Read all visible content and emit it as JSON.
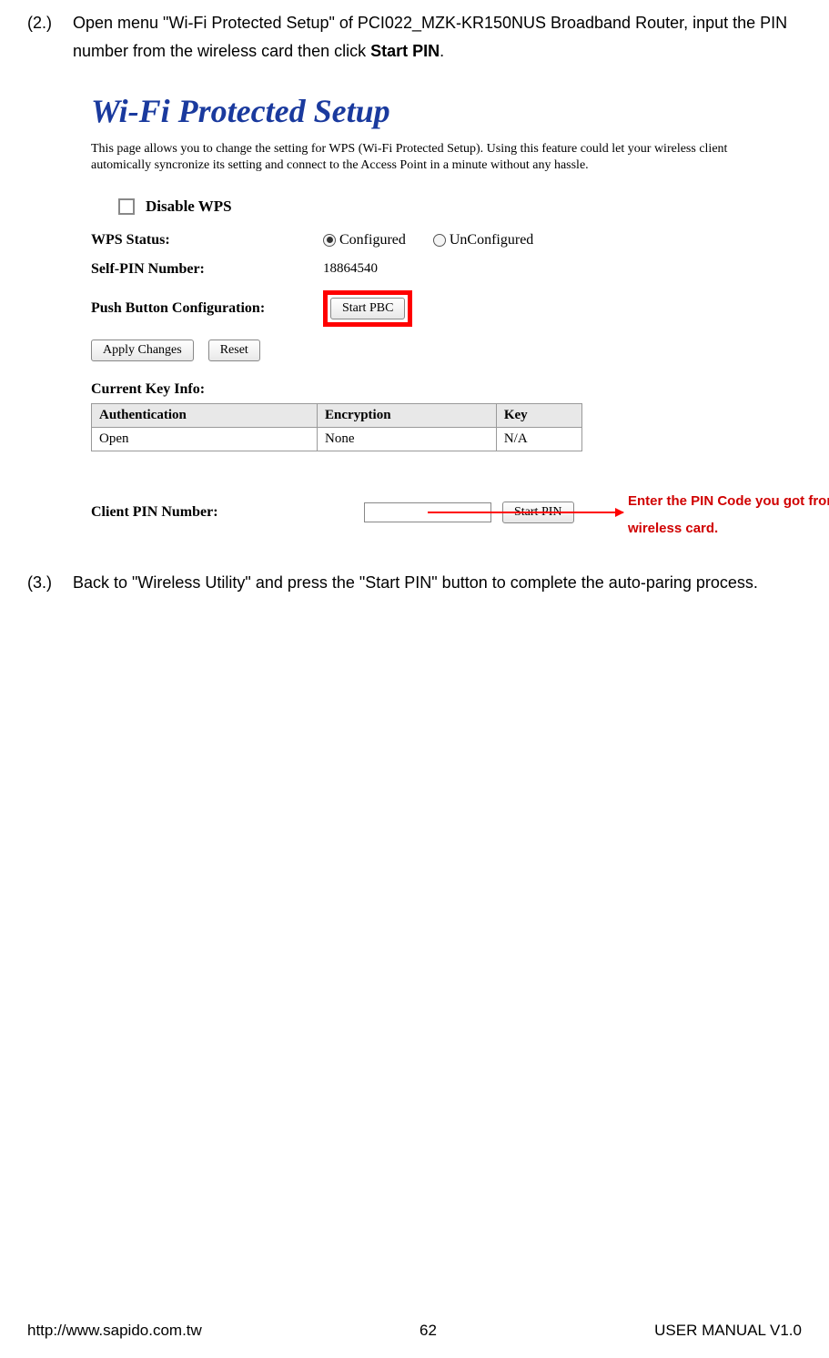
{
  "steps": {
    "s2": {
      "num": "(2.)",
      "text_before": "Open menu \"Wi-Fi Protected Setup\" of PCI022_MZK-KR150NUS Broadband Router, input the PIN number from the wireless card then click ",
      "text_bold": "Start PIN",
      "text_after": "."
    },
    "s3": {
      "num": "(3.)",
      "text": "Back to \"Wireless Utility\" and press the \"Start PIN\" button to complete the auto-paring process."
    }
  },
  "wps": {
    "title": "Wi-Fi Protected Setup",
    "desc": "This page allows you to change the setting for WPS (Wi-Fi Protected Setup). Using this feature could let your wireless client automically syncronize its setting and connect to the Access Point in a minute without any hassle.",
    "disable_label": "Disable WPS",
    "status_label": "WPS Status:",
    "status_configured": "Configured",
    "status_unconfigured": "UnConfigured",
    "self_pin_label": "Self-PIN Number:",
    "self_pin_value": "18864540",
    "pbc_label": "Push Button Configuration:",
    "pbc_button": "Start PBC",
    "apply_button": "Apply Changes",
    "reset_button": "Reset",
    "key_info_label": "Current Key Info:",
    "table": {
      "h1": "Authentication",
      "h2": "Encryption",
      "h3": "Key",
      "r1": "Open",
      "r2": "None",
      "r3": "N/A"
    },
    "client_pin_label": "Client PIN Number:",
    "start_pin_button": "Start PIN"
  },
  "annotation": "Enter the PIN Code you got from the wireless card.",
  "footer": {
    "left": "http://www.sapido.com.tw",
    "center": "62",
    "right": "USER MANUAL V1.0"
  }
}
